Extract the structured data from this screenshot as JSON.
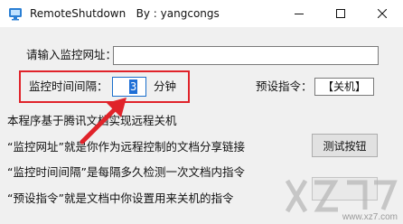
{
  "window": {
    "title": "RemoteShutdown   By : yangcongs"
  },
  "form": {
    "url_label": "请输入监控网址：",
    "url_value": "",
    "interval_label": "监控时间间隔：",
    "interval_value": "3",
    "interval_unit": "分钟",
    "command_label": "预设指令：",
    "command_value": "【关机】"
  },
  "description": [
    "本程序基于腾讯文档实现远程关机",
    "“监控网址”就是你作为远程控制的文档分享链接",
    "“监控时间间隔”是每隔多久检测一次文档内指令",
    "“预设指令”就是文档中你设置用来关机的指令"
  ],
  "buttons": {
    "test_label": "测试按钮"
  },
  "watermark": {
    "text": "www.xz7.com"
  },
  "colors": {
    "highlight": "#e0232a",
    "selection": "#1f6fd6",
    "title_bar": "#ffffff",
    "client_bg": "#f0f0f0"
  }
}
